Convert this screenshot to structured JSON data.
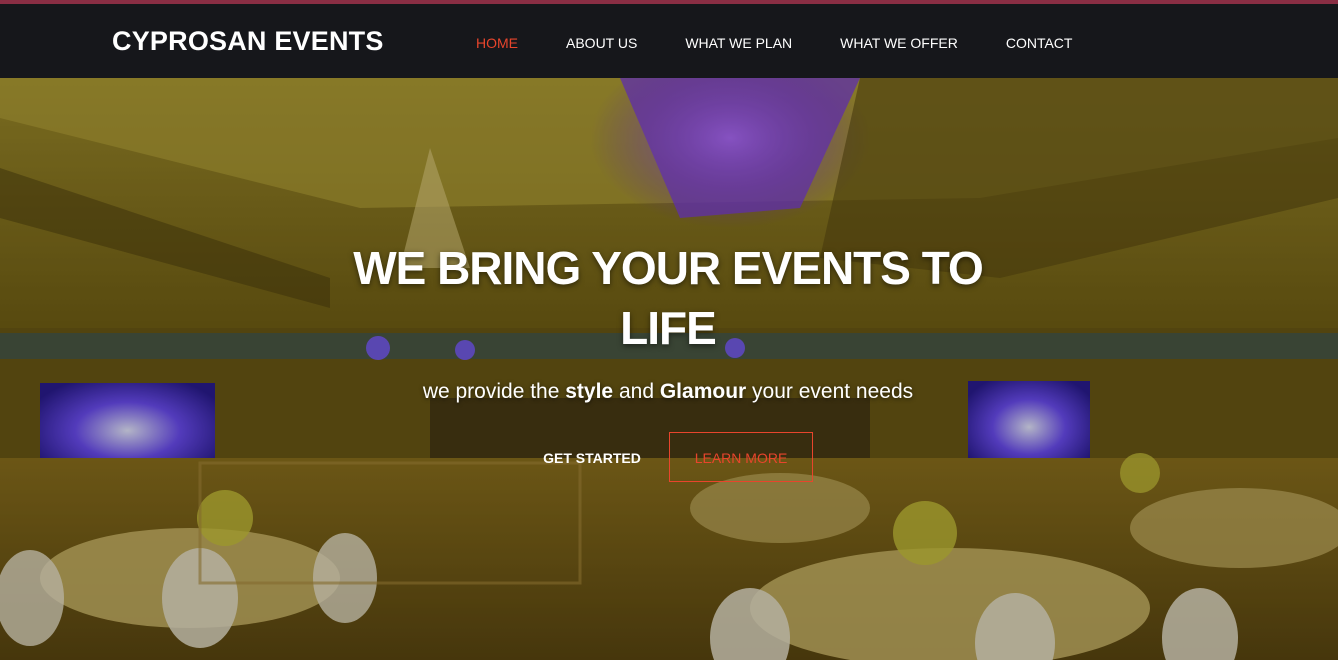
{
  "header": {
    "brand": "CYPROSAN EVENTS",
    "nav": [
      {
        "label": "HOME",
        "active": true
      },
      {
        "label": "ABOUT US",
        "active": false
      },
      {
        "label": "WHAT WE PLAN",
        "active": false
      },
      {
        "label": "WHAT WE OFFER",
        "active": false
      },
      {
        "label": "CONTACT",
        "active": false
      }
    ]
  },
  "hero": {
    "title": "WE BRING YOUR EVENTS TO LIFE",
    "subtitle_parts": {
      "p1": "we provide the ",
      "b1": "style",
      "p2": " and ",
      "b2": "Glamour",
      "p3": " your event needs"
    },
    "primary_button": "GET STARTED",
    "secondary_button": "LEARN MORE",
    "background": "banquet-hall-photo"
  },
  "colors": {
    "accent": "#e8452c",
    "navbar_bg": "#16171b",
    "top_strip": "#8a2e44"
  }
}
